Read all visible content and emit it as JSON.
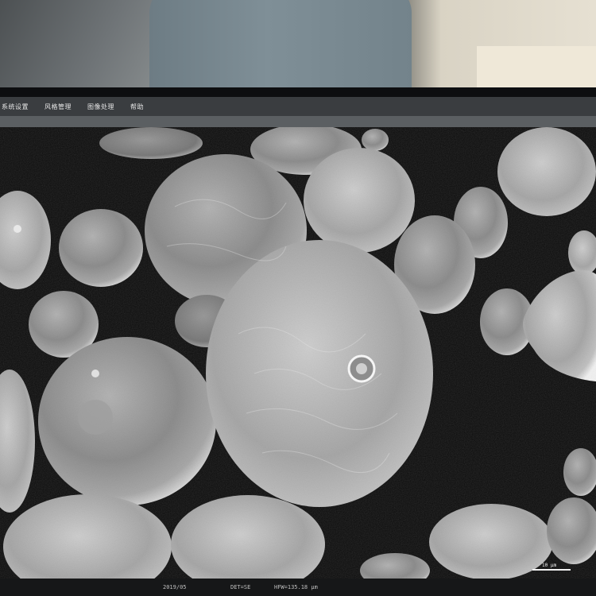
{
  "menu": {
    "items": [
      {
        "label": "系统设置"
      },
      {
        "label": "风格管理"
      },
      {
        "label": "图像处理"
      },
      {
        "label": "帮助"
      }
    ]
  },
  "image": {
    "description_hint": "",
    "scale_bar_label": "10 μm"
  },
  "status": {
    "date": "2019/05",
    "detector": "DET=SE",
    "hfw": "HFW=135.18 μm"
  },
  "colors": {
    "menubar": "#3a3d40",
    "toolbar": "#5b5f62",
    "sem_background": "#0b0b0b",
    "sem_particle": "#bdbdbd"
  }
}
